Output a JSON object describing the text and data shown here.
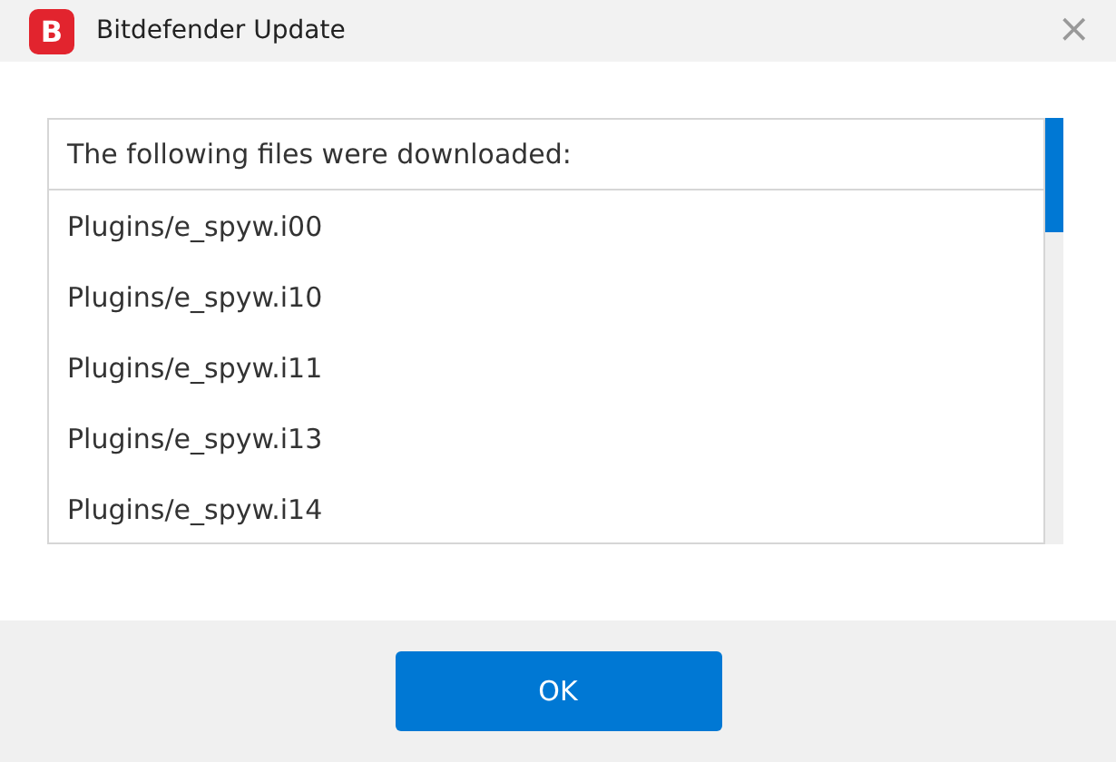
{
  "window": {
    "logo": "B",
    "title": "Bitdefender Update",
    "close": "×"
  },
  "list": {
    "header": "The following files were downloaded:",
    "items": [
      "Plugins/e_spyw.i00",
      "Plugins/e_spyw.i10",
      "Plugins/e_spyw.i11",
      "Plugins/e_spyw.i13",
      "Plugins/e_spyw.i14"
    ]
  },
  "buttons": [
    "OK"
  ]
}
